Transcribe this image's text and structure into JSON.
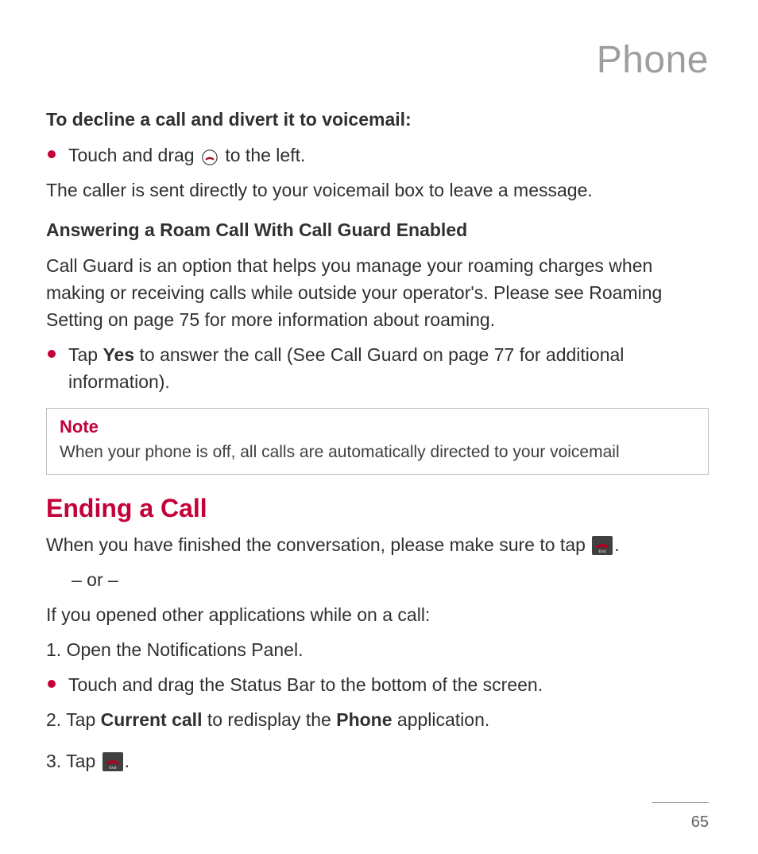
{
  "page": {
    "app_title": "Phone",
    "page_number": "65"
  },
  "headings": {
    "decline_voicemail": "To decline a call and divert it to voicemail:",
    "roam_call_guard": "Answering a Roam Call With Call Guard Enabled",
    "ending_call": "Ending a Call"
  },
  "paragraphs": {
    "touch_drag_pre": "Touch and drag",
    "touch_drag_post": " to the left.",
    "caller_sent": "The caller is sent directly to your voicemail box to leave a message.",
    "call_guard_desc": "Call Guard is an option that helps you manage your roaming charges when making or receiving calls while outside your operator's. Please see Roaming Setting on page 75 for more information about roaming.",
    "tap_yes_pre": "Tap ",
    "tap_yes_bold": "Yes",
    "tap_yes_post": " to answer the call (See Call Guard on page 77 for additional information).",
    "when_finished_pre": "When you have finished the conversation, please make sure to tap ",
    "when_finished_post": ".",
    "or_text": "– or –",
    "if_opened_apps": "If you opened other applications while on a call:",
    "step1": "Open the Notifications Panel.",
    "step1_bullet": "Touch and drag the Status Bar to the bottom of the screen.",
    "step2_pre": "Tap ",
    "step2_bold1": "Current call",
    "step2_mid": " to redisplay the ",
    "step2_bold2": "Phone",
    "step2_post": " application.",
    "step3_pre": "Tap ",
    "step3_post": "."
  },
  "note": {
    "label": "Note",
    "body": "When your phone is off, all calls are automatically directed to your voicemail"
  }
}
